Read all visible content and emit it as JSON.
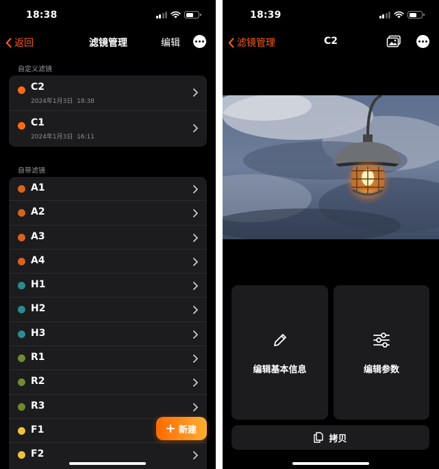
{
  "left": {
    "status": {
      "time": "18:38"
    },
    "nav": {
      "back_label": "返回",
      "title": "滤镜管理",
      "edit_label": "编辑",
      "more_icon": "ellipsis-circle-icon"
    },
    "custom_section": {
      "title": "自定义滤镜",
      "items": [
        {
          "name": "C2",
          "date": "2024年1月3日  18:38",
          "color": "#ff6a13"
        },
        {
          "name": "C1",
          "date": "2024年1月3日  16:11",
          "color": "#ff6a13"
        }
      ]
    },
    "builtin_section": {
      "title": "自带滤镜",
      "items": [
        {
          "name": "A1",
          "color": "#d9621e"
        },
        {
          "name": "A2",
          "color": "#d9621e"
        },
        {
          "name": "A3",
          "color": "#d9621e"
        },
        {
          "name": "A4",
          "color": "#d9621e"
        },
        {
          "name": "H1",
          "color": "#2a8b8f"
        },
        {
          "name": "H2",
          "color": "#2a8b8f"
        },
        {
          "name": "H3",
          "color": "#2a8b8f"
        },
        {
          "name": "R1",
          "color": "#6f8a2f"
        },
        {
          "name": "R2",
          "color": "#6f8a2f"
        },
        {
          "name": "R3",
          "color": "#6f8a2f"
        },
        {
          "name": "F1",
          "color": "#f0c23a"
        },
        {
          "name": "F2",
          "color": "#f0c23a"
        }
      ]
    },
    "fab": {
      "label": "新建",
      "icon": "plus-icon"
    }
  },
  "right": {
    "status": {
      "time": "18:39"
    },
    "nav": {
      "back_label": "滤镜管理",
      "title": "C2",
      "photo_icon": "photo-library-icon",
      "more_icon": "ellipsis-circle-icon"
    },
    "cards": [
      {
        "label": "编辑基本信息",
        "icon": "pencil-icon"
      },
      {
        "label": "编辑参数",
        "icon": "sliders-icon"
      }
    ],
    "copy_button": {
      "label": "拷贝",
      "icon": "copy-doc-icon"
    }
  },
  "colors": {
    "accent": "#ff5a1f",
    "background": "#000000",
    "cell": "#1c1c1e",
    "secondary_text": "#8e8e93"
  }
}
